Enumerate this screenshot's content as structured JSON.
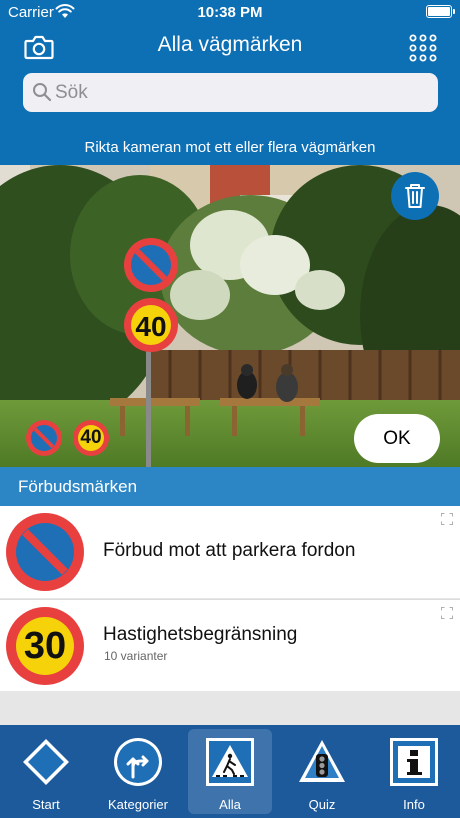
{
  "status_bar": {
    "carrier": "Carrier",
    "time": "10:38 PM"
  },
  "nav": {
    "title": "Alla vägmärken",
    "camera_icon": "camera-icon",
    "grid_icon": "grid-icon"
  },
  "search": {
    "placeholder": "Sök",
    "value": ""
  },
  "camera": {
    "hint": "Rikta kameran mot ett eller flera vägmärken",
    "ok_label": "OK",
    "detected_signs": [
      {
        "icon": "no-parking-sign-icon"
      },
      {
        "icon": "speed-limit-40-sign-icon",
        "text": "40"
      }
    ]
  },
  "section": {
    "title": "Förbudsmärken"
  },
  "list": [
    {
      "title": "Förbud mot att parkera fordon",
      "subtitle": "",
      "icon": "no-parking-sign-icon"
    },
    {
      "title": "Hastighetsbegränsning",
      "subtitle": "10 varianter",
      "icon": "speed-limit-30-sign-icon",
      "sign_text": "30"
    }
  ],
  "tabs": [
    {
      "label": "Start",
      "icon": "diamond-icon",
      "active": false
    },
    {
      "label": "Kategorier",
      "icon": "direction-arrow-icon",
      "active": false
    },
    {
      "label": "Alla",
      "icon": "pedestrian-crossing-icon",
      "active": true
    },
    {
      "label": "Quiz",
      "icon": "traffic-light-icon",
      "active": false
    },
    {
      "label": "Info",
      "icon": "info-icon",
      "active": false
    }
  ],
  "colors": {
    "header_blue": "#0d6fb4",
    "section_blue": "#2c86c6",
    "tabbar_blue": "#1d5a9c",
    "sign_red": "#e8403f",
    "sign_blue": "#1f6fb6",
    "sign_yellow": "#f5d20a"
  }
}
